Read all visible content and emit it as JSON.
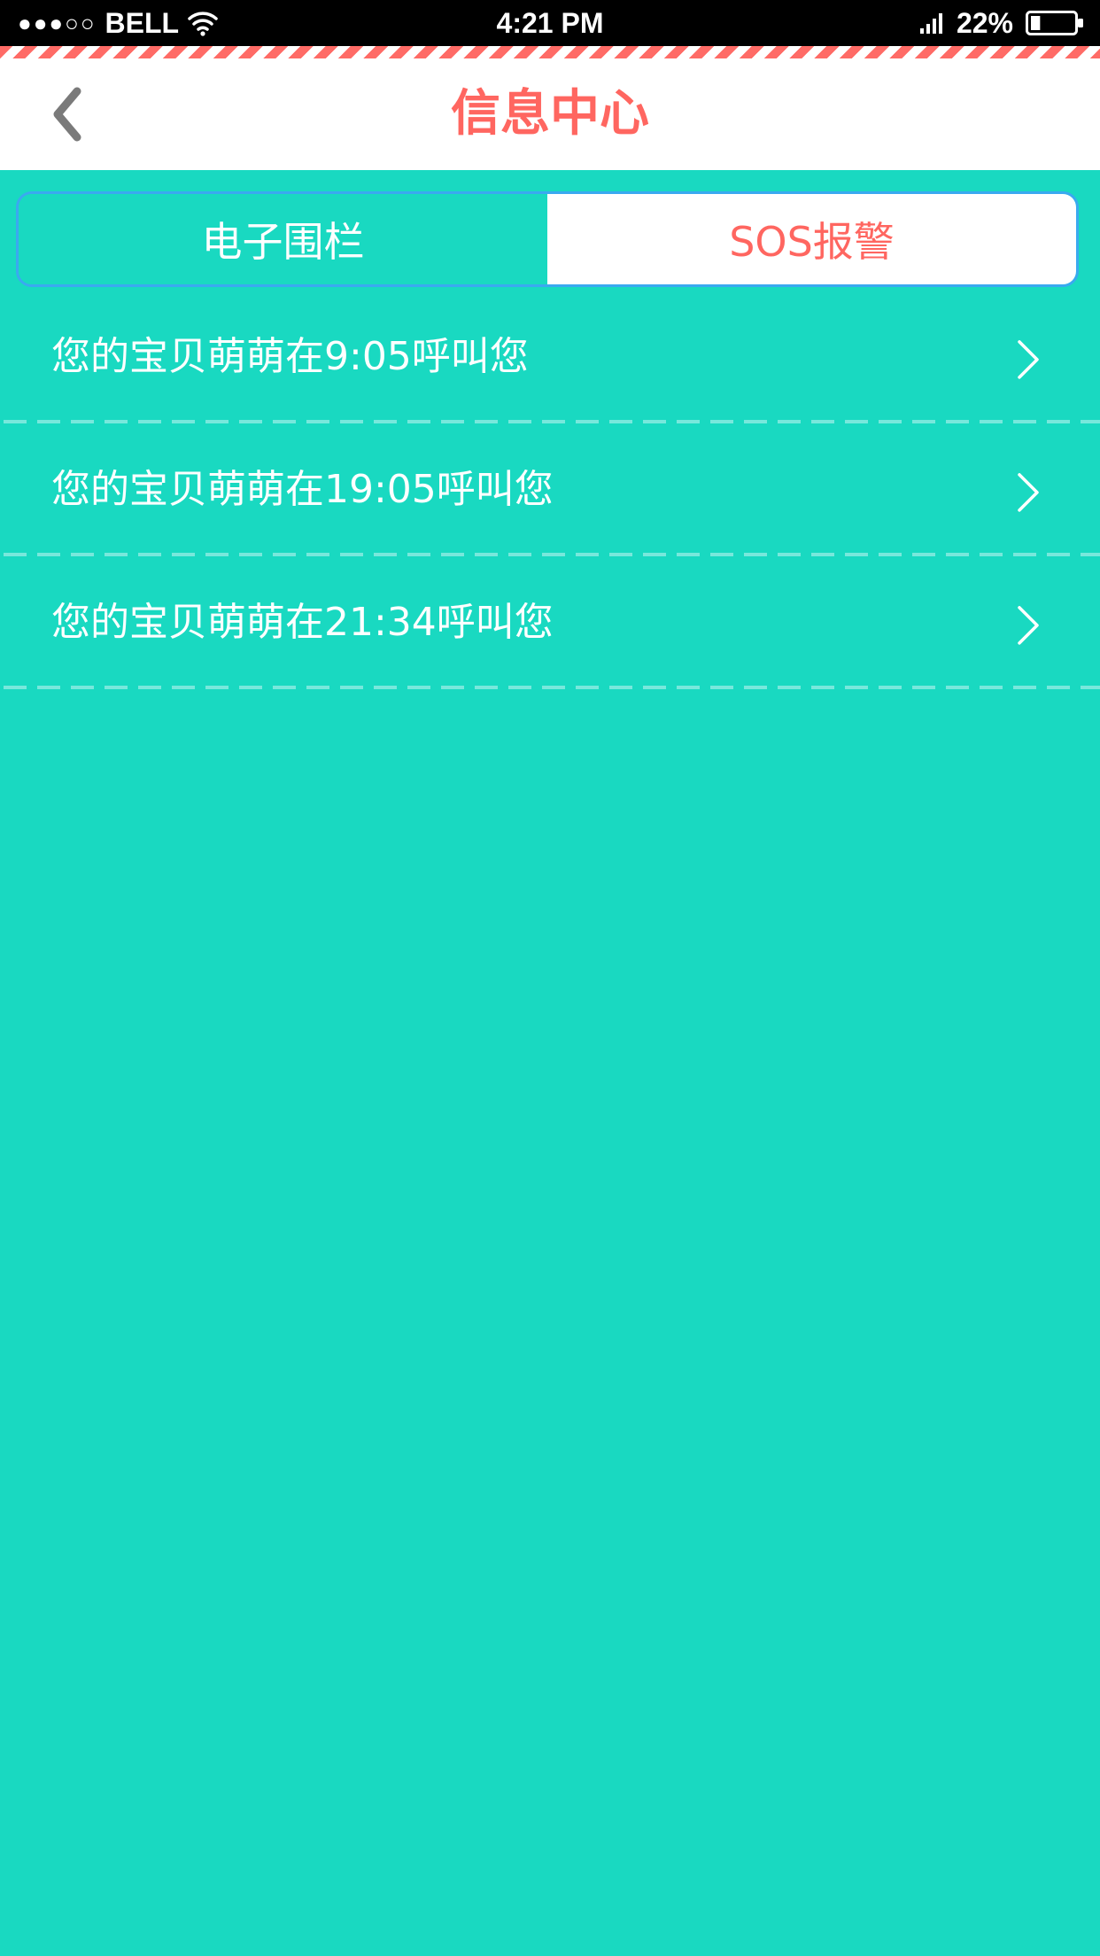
{
  "status_bar": {
    "signal_dots": "●●●○○",
    "carrier": "BELL",
    "time": "4:21 PM",
    "battery_percent": "22%",
    "battery_level": 0.22
  },
  "header": {
    "title": "信息中心",
    "back_icon": "chevron-left-icon"
  },
  "tabs": [
    {
      "label": "电子围栏",
      "selected": false
    },
    {
      "label": "SOS报警",
      "selected": true
    }
  ],
  "messages": [
    {
      "text": "您的宝贝萌萌在9:05呼叫您"
    },
    {
      "text": "您的宝贝萌萌在19:05呼叫您"
    },
    {
      "text": "您的宝贝萌萌在21:34呼叫您"
    }
  ],
  "colors": {
    "background": "#19d9c1",
    "accent": "#ff6660",
    "tab_border": "#3aa9f0",
    "divider": "#78e8dc"
  }
}
